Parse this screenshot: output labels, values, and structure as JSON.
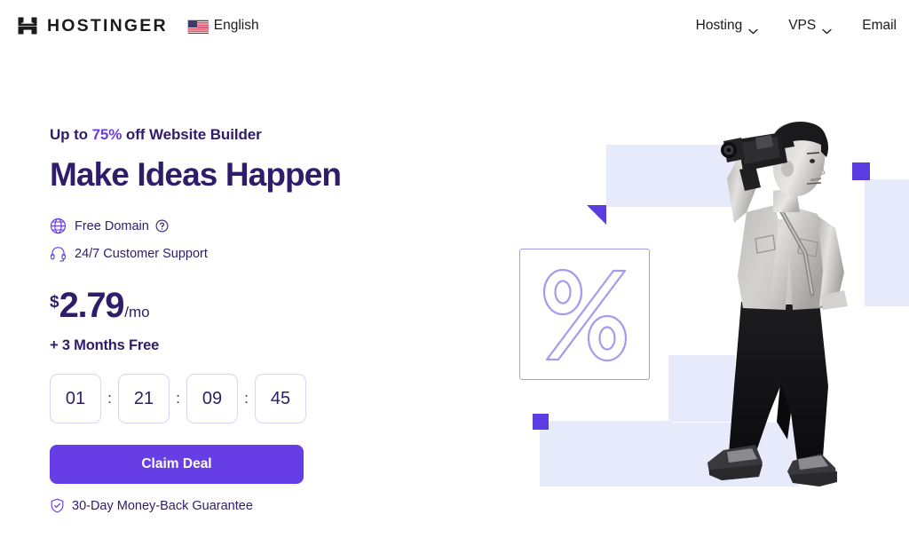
{
  "header": {
    "logo_icon": "hostinger-h-logo",
    "logo_text": "HOSTINGER",
    "language": {
      "flag_icon": "us-flag-icon",
      "label": "English"
    },
    "nav": [
      {
        "label": "Hosting",
        "has_dropdown": true,
        "icon": "chevron-down-icon"
      },
      {
        "label": "VPS",
        "has_dropdown": true,
        "icon": "chevron-down-icon"
      },
      {
        "label": "Email",
        "has_dropdown": false,
        "icon": ""
      }
    ]
  },
  "hero": {
    "eyebrow_prefix": "Up to ",
    "eyebrow_highlight": "75%",
    "eyebrow_suffix": " off Website Builder",
    "headline": "Make Ideas Happen",
    "features": [
      {
        "icon": "globe-icon",
        "label": "Free Domain",
        "help_icon": "question-circle-icon",
        "has_help": true
      },
      {
        "icon": "headset-icon",
        "label": "24/7 Customer Support",
        "help_icon": "",
        "has_help": false
      }
    ],
    "price": {
      "currency": "$",
      "amount": "2.79",
      "period": "/mo"
    },
    "bonus": "+ 3 Months Free",
    "countdown": {
      "separator": ":",
      "units": [
        "01",
        "21",
        "09",
        "45"
      ]
    },
    "cta_label": "Claim Deal",
    "guarantee": {
      "icon": "shield-check-icon",
      "label": "30-Day Money-Back Guarantee"
    },
    "art": {
      "percent_symbol": "%",
      "photo_alt": "man-with-film-camera-photo"
    }
  },
  "colors": {
    "brand_purple": "#673de6",
    "deep_indigo": "#2f1c6a",
    "solid_square": "#5b3ce0",
    "lavender_block": "#e6eafa",
    "outline_purple": "#a79aee",
    "text_dark": "#1b1b1b"
  }
}
